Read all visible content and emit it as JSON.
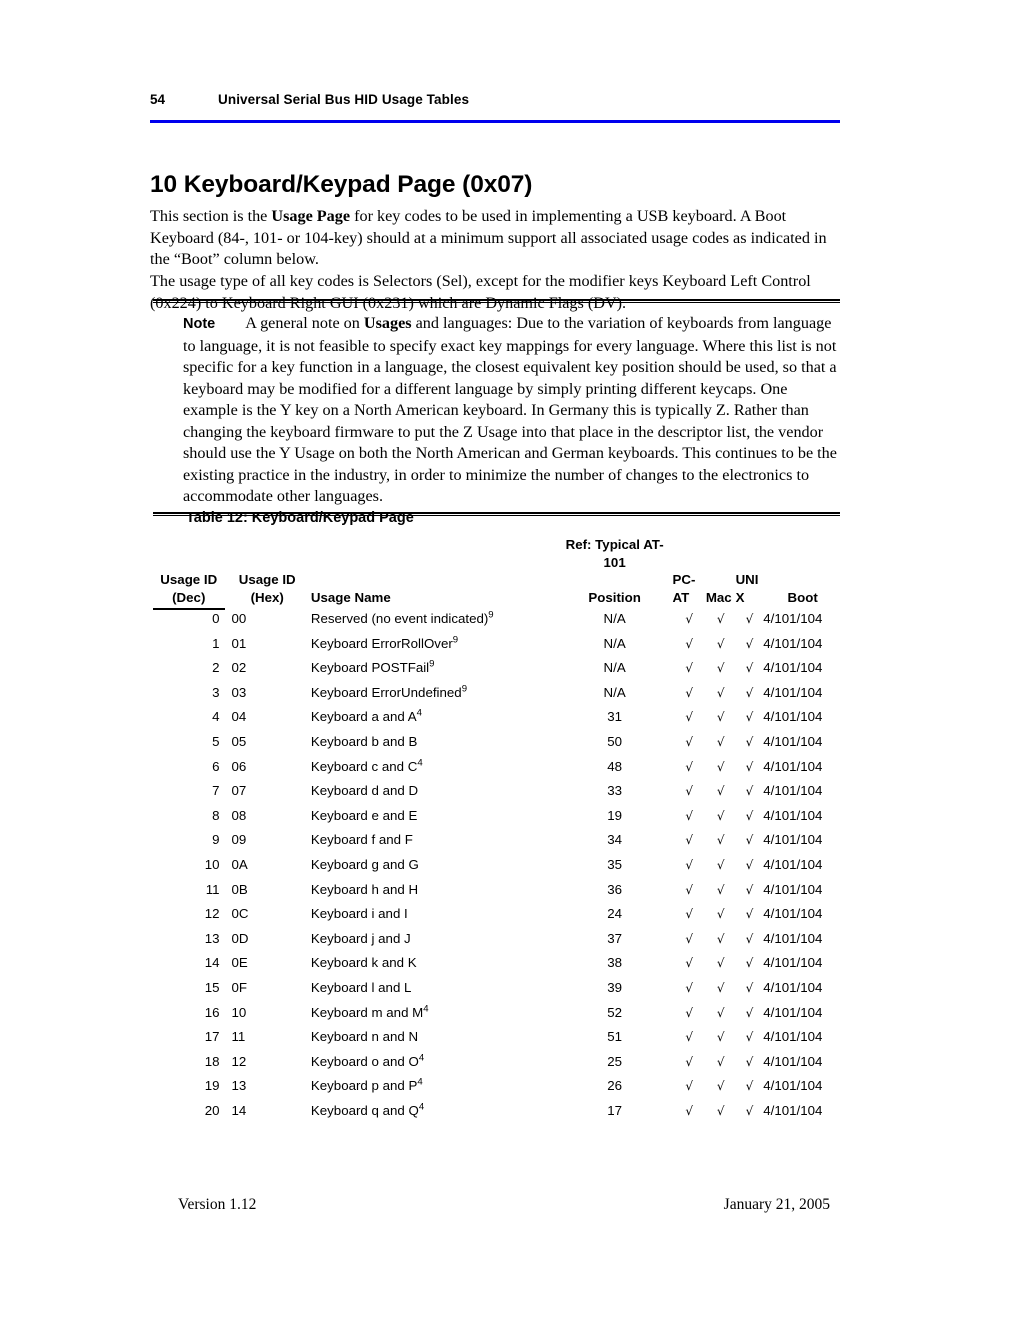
{
  "header": {
    "page_number": "54",
    "title": "Universal Serial Bus HID Usage Tables",
    "rule_color": "#0000ee"
  },
  "section": {
    "heading": "10 Keyboard/Keypad Page (0x07)"
  },
  "paragraphs": {
    "p1_a": "This section is the ",
    "p1_b": "Usage Page",
    "p1_c": " for key codes to be used in implementing a USB keyboard. A Boot Keyboard (84-, 101- or 104-key) should at a minimum support all associated usage codes as indicated in the “Boot” column below.",
    "p2": "The usage type of all key codes is Selectors (Sel), except for the modifier keys Keyboard Left Control (0x224) to Keyboard Right GUI (0x231) which are Dynamic Flags (DV)."
  },
  "note": {
    "label": "Note",
    "text_a": "A general note on ",
    "text_b": "Usages",
    "text_c": " and languages: Due to the variation of keyboards from language to language, it is not feasible to specify exact key mappings for every language. Where this list is not specific for a key function in a language, the closest equivalent key position should be used, so that a keyboard may be modified for a different language by simply printing different keycaps. One example is the Y key on a North American keyboard. In Germany this is typically Z. Rather than changing the keyboard firmware to put the Z Usage into that place in the descriptor list, the vendor should use the Y Usage on both the North American and German keyboards. This continues to be the existing practice in the industry, in order to minimize the number of changes to the electronics to accommodate other languages."
  },
  "table": {
    "caption": "Table 12: Keyboard/Keypad Page",
    "spanner": "Ref: Typical AT-101",
    "headers": {
      "usage_id_dec": "Usage ID\n(Dec)",
      "usage_id_hex": "Usage ID\n(Hex)",
      "usage_name": "Usage Name",
      "position": "Position",
      "pc_at": "PC-\nAT",
      "mac": "Mac",
      "unix": "UNI\nX",
      "boot": "Boot"
    },
    "check_glyph": "√",
    "rows": [
      {
        "dec": "0",
        "hex": "00",
        "name": "Reserved (no event indicated)",
        "sup": "9",
        "pos": "N/A",
        "pc_at": "√",
        "mac": "√",
        "unix": "√",
        "boot": "4/101/104"
      },
      {
        "dec": "1",
        "hex": "01",
        "name": "Keyboard ErrorRollOver",
        "sup": "9",
        "pos": "N/A",
        "pc_at": "√",
        "mac": "√",
        "unix": "√",
        "boot": "4/101/104"
      },
      {
        "dec": "2",
        "hex": "02",
        "name": "Keyboard POSTFail",
        "sup": "9",
        "pos": "N/A",
        "pc_at": "√",
        "mac": "√",
        "unix": "√",
        "boot": "4/101/104"
      },
      {
        "dec": "3",
        "hex": "03",
        "name": "Keyboard ErrorUndefined",
        "sup": "9",
        "pos": "N/A",
        "pc_at": "√",
        "mac": "√",
        "unix": "√",
        "boot": "4/101/104"
      },
      {
        "dec": "4",
        "hex": "04",
        "name": "Keyboard a and A",
        "sup": "4",
        "pos": "31",
        "pc_at": "√",
        "mac": "√",
        "unix": "√",
        "boot": "4/101/104"
      },
      {
        "dec": "5",
        "hex": "05",
        "name": "Keyboard b and B",
        "sup": "",
        "pos": "50",
        "pc_at": "√",
        "mac": "√",
        "unix": "√",
        "boot": "4/101/104"
      },
      {
        "dec": "6",
        "hex": "06",
        "name": "Keyboard c and C",
        "sup": "4",
        "pos": "48",
        "pc_at": "√",
        "mac": "√",
        "unix": "√",
        "boot": "4/101/104"
      },
      {
        "dec": "7",
        "hex": "07",
        "name": "Keyboard d and D",
        "sup": "",
        "pos": "33",
        "pc_at": "√",
        "mac": "√",
        "unix": "√",
        "boot": "4/101/104"
      },
      {
        "dec": "8",
        "hex": "08",
        "name": "Keyboard e and E",
        "sup": "",
        "pos": "19",
        "pc_at": "√",
        "mac": "√",
        "unix": "√",
        "boot": "4/101/104"
      },
      {
        "dec": "9",
        "hex": "09",
        "name": "Keyboard f and F",
        "sup": "",
        "pos": "34",
        "pc_at": "√",
        "mac": "√",
        "unix": "√",
        "boot": "4/101/104"
      },
      {
        "dec": "10",
        "hex": "0A",
        "name": "Keyboard g and G",
        "sup": "",
        "pos": "35",
        "pc_at": "√",
        "mac": "√",
        "unix": "√",
        "boot": "4/101/104"
      },
      {
        "dec": "11",
        "hex": "0B",
        "name": "Keyboard h and H",
        "sup": "",
        "pos": "36",
        "pc_at": "√",
        "mac": "√",
        "unix": "√",
        "boot": "4/101/104"
      },
      {
        "dec": "12",
        "hex": "0C",
        "name": "Keyboard i and I",
        "sup": "",
        "pos": "24",
        "pc_at": "√",
        "mac": "√",
        "unix": "√",
        "boot": "4/101/104"
      },
      {
        "dec": "13",
        "hex": "0D",
        "name": "Keyboard j and J",
        "sup": "",
        "pos": "37",
        "pc_at": "√",
        "mac": "√",
        "unix": "√",
        "boot": "4/101/104"
      },
      {
        "dec": "14",
        "hex": "0E",
        "name": "Keyboard k and K",
        "sup": "",
        "pos": "38",
        "pc_at": "√",
        "mac": "√",
        "unix": "√",
        "boot": "4/101/104"
      },
      {
        "dec": "15",
        "hex": "0F",
        "name": "Keyboard l and L",
        "sup": "",
        "pos": "39",
        "pc_at": "√",
        "mac": "√",
        "unix": "√",
        "boot": "4/101/104"
      },
      {
        "dec": "16",
        "hex": "10",
        "name": "Keyboard m and M",
        "sup": "4",
        "pos": "52",
        "pc_at": "√",
        "mac": "√",
        "unix": "√",
        "boot": "4/101/104"
      },
      {
        "dec": "17",
        "hex": "11",
        "name": "Keyboard n and N",
        "sup": "",
        "pos": "51",
        "pc_at": "√",
        "mac": "√",
        "unix": "√",
        "boot": "4/101/104"
      },
      {
        "dec": "18",
        "hex": "12",
        "name": "Keyboard o and O",
        "sup": "4",
        "pos": "25",
        "pc_at": "√",
        "mac": "√",
        "unix": "√",
        "boot": "4/101/104"
      },
      {
        "dec": "19",
        "hex": "13",
        "name": "Keyboard p and P",
        "sup": "4",
        "pos": "26",
        "pc_at": "√",
        "mac": "√",
        "unix": "√",
        "boot": "4/101/104"
      },
      {
        "dec": "20",
        "hex": "14",
        "name": "Keyboard q and Q",
        "sup": "4",
        "pos": "17",
        "pc_at": "√",
        "mac": "√",
        "unix": "√",
        "boot": "4/101/104"
      }
    ]
  },
  "footer": {
    "version": "Version 1.12",
    "date": "January 21, 2005"
  }
}
